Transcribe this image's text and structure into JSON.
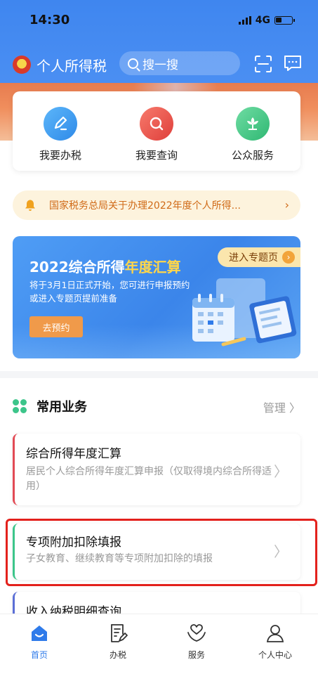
{
  "status_bar": {
    "time": "14:30",
    "network": "4G"
  },
  "header": {
    "app_title": "个人所得税",
    "search_placeholder": "搜一搜",
    "icons": {
      "emblem": "national-emblem-icon",
      "scan": "scan-icon",
      "message": "message-icon"
    },
    "colors": {
      "primary": "#3f86ef"
    }
  },
  "quick_actions": [
    {
      "label": "我要办税",
      "icon": "pen-icon",
      "color": "#3a9df0"
    },
    {
      "label": "我要查询",
      "icon": "magnifier-icon",
      "color": "#e5504a"
    },
    {
      "label": "公众服务",
      "icon": "flower-icon",
      "color": "#43c584"
    }
  ],
  "notice": {
    "text": "国家税务总局关于办理2022年度个人所得...",
    "arrow": "›",
    "icon": "bell-icon",
    "color": "#d06a17"
  },
  "banner": {
    "entry_label": "进入专题页",
    "entry_arrow": "›",
    "title_prefix": "2022综合所得",
    "title_highlight": "年度汇算",
    "subtitle": "将于3月1日正式开始，您可进行申报预约或进入专题页提前准备",
    "button_label": "去预约"
  },
  "section": {
    "title": "常用业务",
    "manage_label": "管理 〉"
  },
  "business_items": [
    {
      "title": "综合所得年度汇算",
      "description": "居民个人综合所得年度汇算申报（仅取得境内综合所得适用）",
      "accent": "#e24b55",
      "chevron": "〉"
    },
    {
      "title": "专项附加扣除填报",
      "description": "子女教育、继续教育等专项附加扣除的填报",
      "accent": "#3cc58a",
      "chevron": "〉"
    },
    {
      "title": "收入纳税明细查询",
      "description": "",
      "accent": "#5b6fd6",
      "chevron": ""
    }
  ],
  "tabs": [
    {
      "label": "首页",
      "icon": "home-icon",
      "active": true
    },
    {
      "label": "办税",
      "icon": "document-edit-icon",
      "active": false
    },
    {
      "label": "服务",
      "icon": "heart-hands-icon",
      "active": false
    },
    {
      "label": "个人中心",
      "icon": "person-icon",
      "active": false
    }
  ]
}
